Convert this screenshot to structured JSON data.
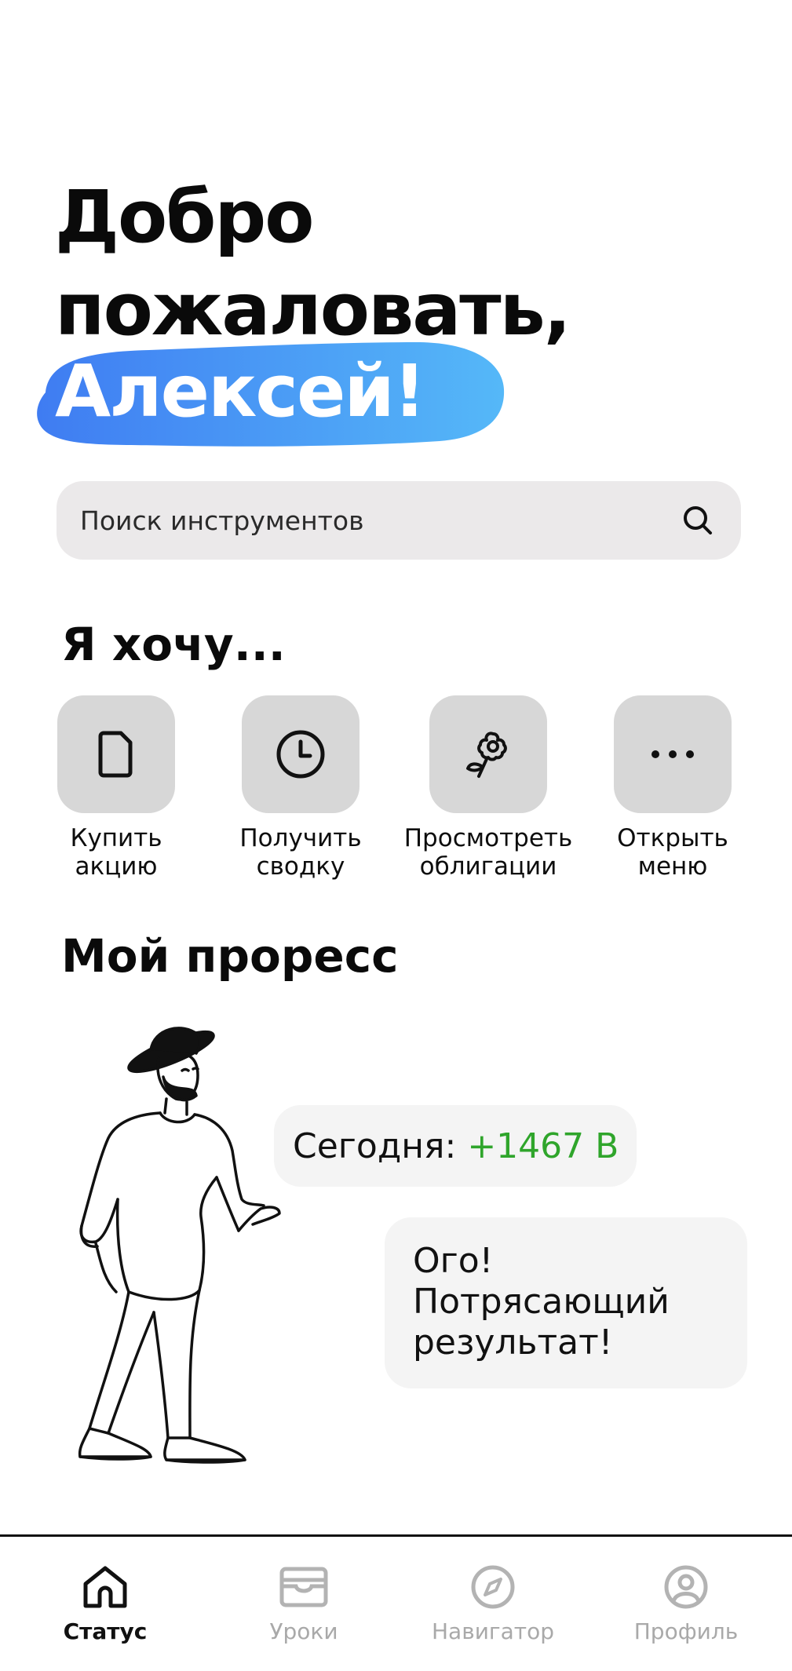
{
  "header": {
    "greeting_line1": "Добро",
    "greeting_line2": "пожаловать,",
    "user_name": "Алексей!"
  },
  "colors": {
    "accent_blue_start": "#3f7cf2",
    "accent_blue_end": "#55b8f8",
    "positive_green": "#2fa52b",
    "tile_gray": "#d7d7d7",
    "inactive_tab": "#a9a9a9"
  },
  "search": {
    "placeholder": "Поиск инструментов",
    "icon": "search-icon"
  },
  "actions": {
    "title": "Я хочу...",
    "items": [
      {
        "line1": "Купить",
        "line2": "акцию",
        "icon": "document-icon"
      },
      {
        "line1": "Получить",
        "line2": "сводку",
        "icon": "clock-icon"
      },
      {
        "line1": "Просмотреть",
        "line2": "облигации",
        "icon": "flower-icon"
      },
      {
        "line1": "Открыть",
        "line2": "меню",
        "icon": "more-dots-icon"
      }
    ]
  },
  "progress": {
    "title": "Мой проресс",
    "today_label": "Сегодня:",
    "today_value": "+1467 В",
    "comment_line1": "Ого!",
    "comment_line2": "Потрясающий",
    "comment_line3": "результат!"
  },
  "tabbar": {
    "items": [
      {
        "label": "Статус",
        "icon": "home-icon",
        "active": true
      },
      {
        "label": "Уроки",
        "icon": "inbox-icon",
        "active": false
      },
      {
        "label": "Навигатор",
        "icon": "compass-icon",
        "active": false
      },
      {
        "label": "Профиль",
        "icon": "profile-icon",
        "active": false
      }
    ]
  }
}
